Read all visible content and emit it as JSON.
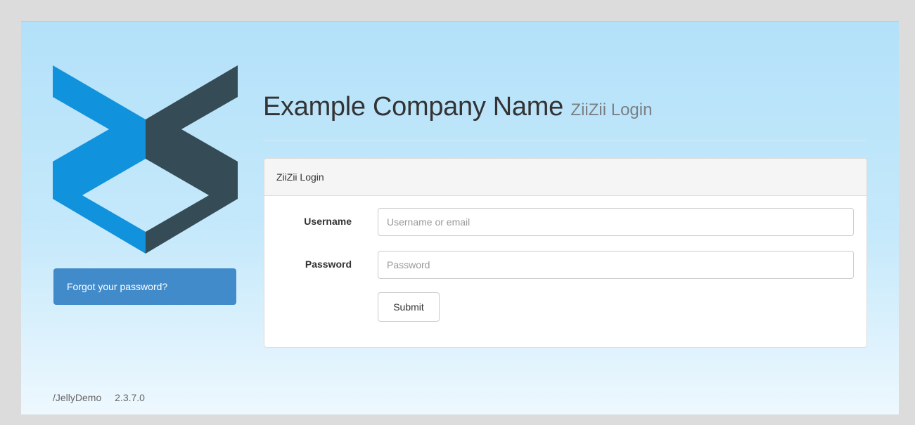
{
  "colors": {
    "page_background": "#dcdcdc",
    "banner_gradient_top": "#b3e1f9",
    "banner_gradient_bottom": "#eef8fe",
    "logo_blue": "#1192dd",
    "logo_dark": "#354b55",
    "primary_button": "#428bca"
  },
  "logo": {
    "icon": "company-logo"
  },
  "sidebar": {
    "forgot_password_label": "Forgot your password?"
  },
  "header": {
    "company_name": "Example Company Name",
    "subtitle": "ZiiZii Login"
  },
  "login_panel": {
    "title": "ZiiZii Login",
    "username_label": "Username",
    "username_placeholder": "Username or email",
    "username_value": "",
    "password_label": "Password",
    "password_placeholder": "Password",
    "password_value": "",
    "submit_label": "Submit"
  },
  "footer": {
    "app_path": "/JellyDemo",
    "version": "2.3.7.0"
  }
}
